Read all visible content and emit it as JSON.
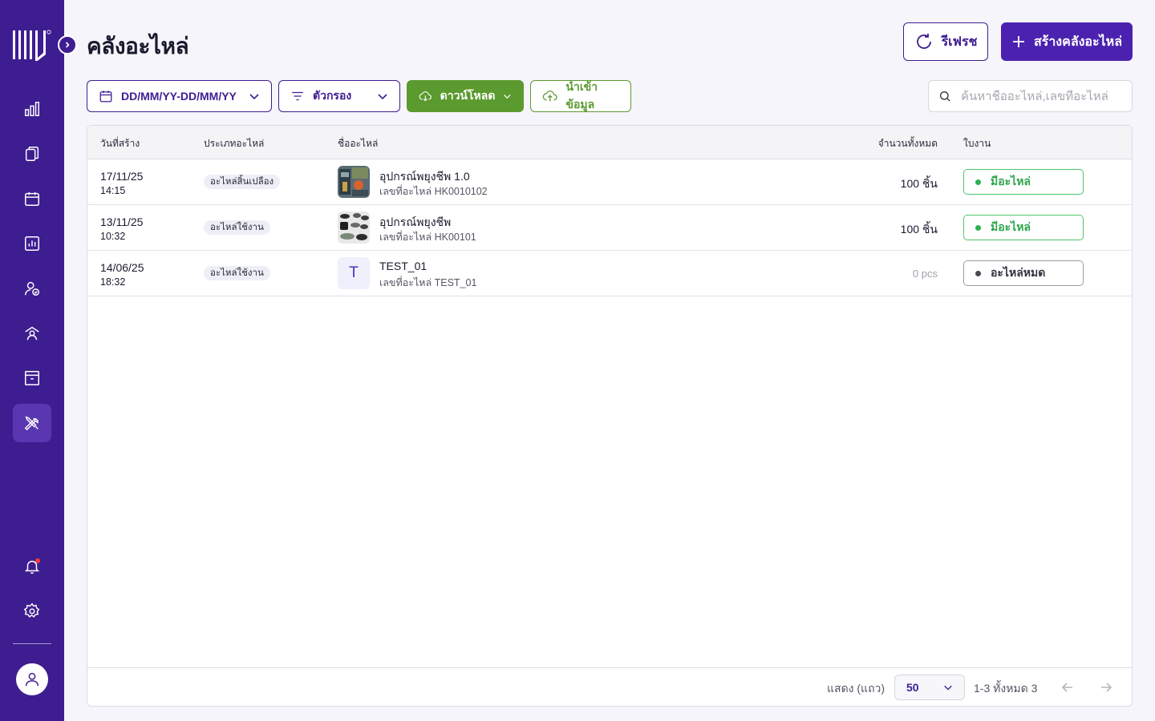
{
  "page": {
    "title": "คลังอะไหล่"
  },
  "header": {
    "refresh_label": "รีเฟรช",
    "create_label": "สร้างคลังอะไหล่"
  },
  "toolbar": {
    "date_range_label": "DD/MM/YY-DD/MM/YY",
    "filter_label": "ตัวกรอง",
    "download_label": "ดาวน์โหลด",
    "import_label": "นำเข้าข้อมูล",
    "search_placeholder": "ค้นหาชื่ออะไหล่,เลขที่อะไหล่"
  },
  "table": {
    "columns": {
      "created": "วันที่สร้าง",
      "type": "ประเภทอะไหล่",
      "name": "ชื่ออะไหล่",
      "total": "จำนวนทั้งหมด",
      "workorder": "ใบงาน"
    },
    "rows": [
      {
        "date": "17/11/25",
        "time": "14:15",
        "type": "อะไหล่สิ้นเปลือง",
        "name": "อุปกรณ์พยุงชีพ 1.0",
        "part_no": "เลขที่อะไหล่ HK0010102",
        "qty": "100 ชิ้น",
        "status": "มีอะไหล่",
        "thumb": "photo-machine"
      },
      {
        "date": "13/11/25",
        "time": "10:32",
        "type": "อะไหล่ใช้งาน",
        "name": "อุปกรณ์พยุงชีพ",
        "part_no": "เลขที่อะไหล่ HK00101",
        "qty": "100 ชิ้น",
        "status": "มีอะไหล่",
        "thumb": "photo-parts"
      },
      {
        "date": "14/06/25",
        "time": "18:32",
        "type": "อะไหล่ใช้งาน",
        "name": "TEST_01",
        "part_no": "เลขที่อะไหล่ TEST_01",
        "qty": "0 pcs",
        "status": "อะไหล่หมด",
        "thumb_letter": "T"
      }
    ]
  },
  "pagination": {
    "rows_label": "แสดง (แถว)",
    "rows_value": "50",
    "range_text": "1-3 ทั้งหมด 3"
  },
  "colors": {
    "sidebar": "#3e1d91",
    "primary": "#4b22b0",
    "success": "#5b9a2e",
    "in_stock": "#2bb24f"
  }
}
